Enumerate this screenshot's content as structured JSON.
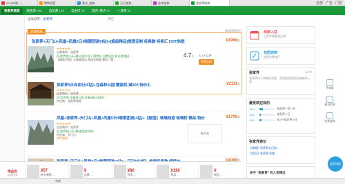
{
  "browser": {
    "tabs": [
      {
        "label": "2018年第一..."
      },
      {
        "label": "鸭鸭经营..."
      },
      {
        "label": "景点_旅游..."
      },
      {
        "label": "天天旅游..."
      },
      {
        "label": "金车旅游..."
      },
      {
        "label": "张家界旅游..."
      }
    ],
    "actions": [
      "全部",
      "广告",
      "门票"
    ]
  },
  "nav": {
    "tabs": [
      {
        "label": "张家界旅游",
        "count": ""
      },
      {
        "label": "跟团游",
        "count": "348"
      },
      {
        "label": "自助游",
        "count": "169"
      },
      {
        "label": "自由行",
        "count": "34"
      },
      {
        "label": "酒店+景点",
        "count": "30"
      },
      {
        "label": "一日游",
        "count": "33"
      }
    ]
  },
  "location": {
    "from": "出发城市：",
    "city": "张家界",
    "clear": "清空"
  },
  "list": {
    "hot_tag": "热销推荐",
    "hot_right": "旅游搜索排行",
    "items": [
      {
        "title": "张家界+天门山+凤凰+凤凰5日4晚跟团游(4钻)+[超级精品]情景定制 经典款 特卖汇 HOT热销",
        "stars": "★★★★★",
        "price": "1988",
        "price_unit": "起",
        "meta": [
          "出发城市：张家界",
          "[行程特色] 5天4晚 自营产品 门票特价 自费项目 含导游 跟团 ...",
          "【精选行程】五星级酒店 纯玩无购物 景区门票 ..."
        ],
        "score": "4.7",
        "score_unit": "分",
        "reviews": "324人点评",
        "btn": "免费咨询"
      },
      {
        "title": "张家界5日自由行(5钻)+住森林公园 赠接机 减300 特价汇",
        "stars": "★★★★★",
        "price": "2111",
        "price_unit": "起",
        "meta": [
          "出发城市：张家界",
          "[产品特色] 住森林公园 含接送机 自由行 ...",
          "供应商：张家界旅游"
        ]
      },
      {
        "title": "凤凰+张家界+天门山+凤凰+凤凰5日4晚跟团游(4钻)+【超值】玻璃栈道 玻璃桥 精品 特价",
        "stars": "★★★★★",
        "price": "1799",
        "price_unit": "起",
        "meta": [
          "出发城市：张家界",
          "[行程特色] 5天4晚 跟团游 特价 ...",
          "供应商：天门山",
          "途牛旅游"
        ],
        "ad": "新产品"
      },
      {
        "title": "张家界+天门山+凤凰5日4晚跟团游(3钻)+【万达在线】 热销经典款 超值价",
        "stars": "★★★★★",
        "price": "1080",
        "price_unit": "起",
        "meta": [
          "出发城市：张家界"
        ]
      }
    ]
  },
  "sidebar": {
    "merchant": {
      "title": "商家入驻",
      "sub": "打造专属旅游品牌"
    },
    "custom": {
      "title": "包团定制",
      "sub": "定制专属旅行"
    },
    "dest": {
      "title": "张家界",
      "weather": "20℃",
      "desc": "张家界位于湖南西北部，是我国首批国家级森林公园..."
    },
    "popular": {
      "title": "最受欢迎目的",
      "rows": [
        {
          "pct": "21%",
          "value": 0.21,
          "label": "张家界一地 7日"
        },
        {
          "pct": "10%",
          "value": 0.1,
          "label": "张家界 5日"
        },
        {
          "pct": "12%",
          "value": 0.12,
          "label": "长沙+张家界 6日"
        }
      ]
    },
    "notes": {
      "title": "张家界游记",
      "rows": [
        "【攻略】张家界五日游 ...",
        "【游记】张家界 凤凰 ..."
      ]
    }
  },
  "tools": [
    {
      "label": "手机版"
    },
    {
      "label": "意见反馈"
    },
    {
      "label": "在线咨询"
    }
  ],
  "float": {
    "label": "返回顶部"
  },
  "adstrip": {
    "logo": "唯品会",
    "logo_sub": "品牌特卖",
    "cells": [
      {
        "price": "¥57",
        "text": "秋冬新款 ..."
      },
      {
        "price": "¥",
        "text": "品牌 ..."
      },
      {
        "price": "¥80",
        "text": "时尚 ..."
      },
      {
        "price": "¥118",
        "text": "热卖 ..."
      },
      {
        "price": "¥",
        "text": "新品 ..."
      }
    ]
  },
  "bottom_banner": "关于 \"张家界\" 的人还搜过",
  "status": "完成"
}
